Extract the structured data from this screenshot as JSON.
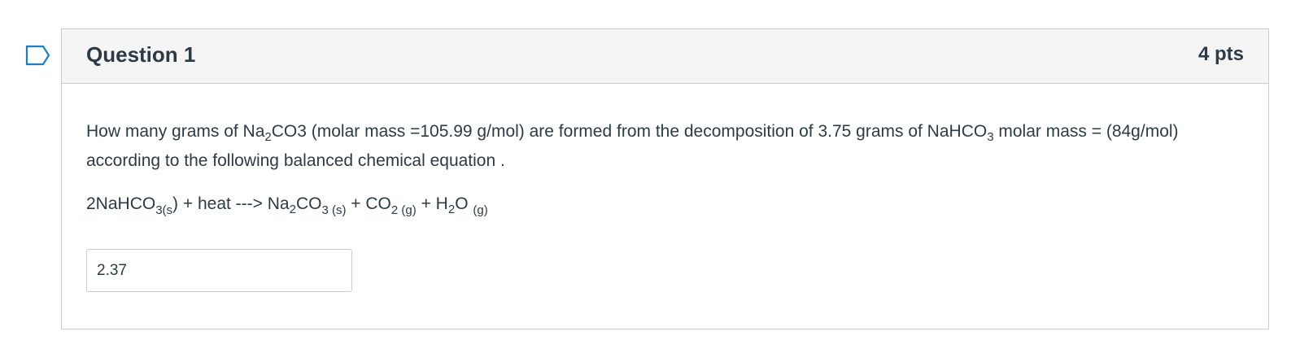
{
  "question": {
    "title": "Question 1",
    "points": "4 pts",
    "flag_icon": "bookmark-flag-icon",
    "text": {
      "part1": "How many grams of Na",
      "sub_na2": "2",
      "part2": "CO3  (molar mass =105.99 g/mol) are formed from the decomposition of 3.75 grams of NaHCO",
      "sub_o3": "3",
      "part3": "  molar mass = (84g/mol) according to the following balanced chemical equation ."
    },
    "equation": {
      "t1": "2NaHCO",
      "s1": "3(s",
      "t2": ")  + heat ---> Na",
      "s2": "2",
      "t3": "CO",
      "s3": "3 (s)",
      "t4": "  + CO",
      "s4": "2 (g)",
      "t5": "  + H",
      "s5": "2",
      "t6": "O ",
      "s6": "(g)"
    },
    "answer_value": "2.37"
  },
  "colors": {
    "text": "#2d3b45",
    "header_bg": "#f5f5f5",
    "border": "#c7cdd1",
    "flag": "#1c7ec7"
  }
}
